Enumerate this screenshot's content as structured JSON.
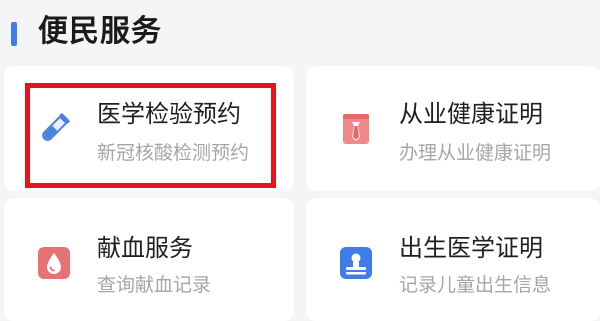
{
  "section": {
    "title": "便民服务"
  },
  "colors": {
    "accent": "#3f7de8",
    "highlight": "#e8141c",
    "title_text": "#1f1f1f",
    "subtitle_text": "#a6a6a6"
  },
  "services": [
    {
      "title": "医学检验预约",
      "subtitle": "新冠核酸检测预约",
      "icon": "test-tube-icon",
      "highlighted": true
    },
    {
      "title": "从业健康证明",
      "subtitle": "办理从业健康证明",
      "icon": "id-badge-icon",
      "highlighted": false
    },
    {
      "title": "献血服务",
      "subtitle": "查询献血记录",
      "icon": "blood-drop-icon",
      "highlighted": false
    },
    {
      "title": "出生医学证明",
      "subtitle": "记录儿童出生信息",
      "icon": "birth-certificate-icon",
      "highlighted": false
    }
  ]
}
